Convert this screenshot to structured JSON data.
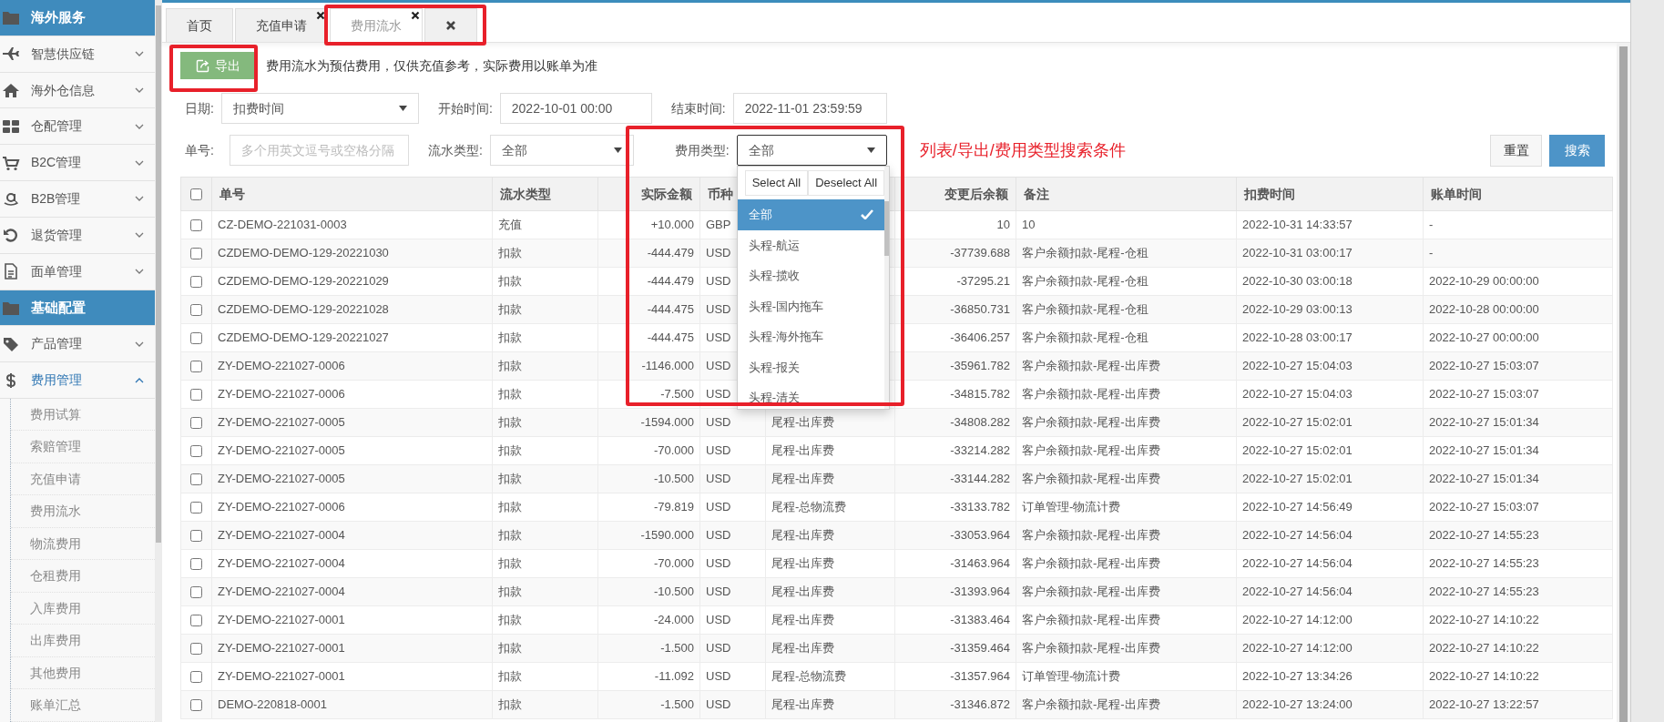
{
  "sidebar": {
    "items": [
      {
        "kind": "section",
        "label": "海外服务"
      },
      {
        "kind": "menu",
        "label": "智慧供应链",
        "expanded": false
      },
      {
        "kind": "menu",
        "label": "海外仓信息",
        "expanded": false
      },
      {
        "kind": "menu",
        "label": "仓配管理",
        "expanded": false
      },
      {
        "kind": "menu",
        "label": "B2C管理",
        "expanded": false
      },
      {
        "kind": "menu",
        "label": "B2B管理",
        "expanded": false
      },
      {
        "kind": "menu",
        "label": "退货管理",
        "expanded": false
      },
      {
        "kind": "menu",
        "label": "面单管理",
        "expanded": false
      },
      {
        "kind": "section",
        "label": "基础配置"
      },
      {
        "kind": "menu",
        "label": "产品管理",
        "expanded": false
      },
      {
        "kind": "menu",
        "label": "费用管理",
        "expanded": true,
        "children": [
          {
            "label": "费用试算"
          },
          {
            "label": "索赔管理"
          },
          {
            "label": "充值申请"
          },
          {
            "label": "费用流水"
          },
          {
            "label": "物流费用"
          },
          {
            "label": "仓租费用"
          },
          {
            "label": "入库费用"
          },
          {
            "label": "出库费用"
          },
          {
            "label": "其他费用"
          },
          {
            "label": "账单汇总"
          }
        ]
      }
    ]
  },
  "tabs": [
    {
      "kind": "page",
      "label": "首页",
      "selected": false,
      "closable": false
    },
    {
      "kind": "page",
      "label": "充值申请",
      "selected": false,
      "closable": true
    },
    {
      "kind": "page",
      "label": "费用流水",
      "selected": true,
      "closable": true
    },
    {
      "kind": "close_all",
      "selected": false
    }
  ],
  "toolbar": {
    "export_button": "导出",
    "notice": "费用流水为预估费用，仅供充值参考，实际费用以账单为准"
  },
  "filters": {
    "date_label": "日期:",
    "date_type": "扣费时间",
    "start_label": "开始时间:",
    "start_time": "2022-10-01 00:00",
    "end_label": "结束时间:",
    "end_time": "2022-11-01 23:59:59",
    "order_label": "单号:",
    "order_placeholder": "多个用英文逗号或空格分隔",
    "flow_type_label": "流水类型:",
    "flow_type": "全部",
    "fee_type_label": "费用类型:",
    "fee_type": "全部",
    "annotation": "列表/导出/费用类型搜索条件",
    "buttons": [
      "重置",
      "搜索"
    ]
  },
  "fee_type_dropdown": {
    "actions": [
      "Select All",
      "Deselect All"
    ],
    "options": [
      {
        "label": "全部",
        "selected": true
      },
      {
        "label": "头程-航运",
        "selected": false
      },
      {
        "label": "头程-揽收",
        "selected": false
      },
      {
        "label": "头程-国内拖车",
        "selected": false
      },
      {
        "label": "头程-海外拖车",
        "selected": false
      },
      {
        "label": "头程-报关",
        "selected": false
      },
      {
        "label": "头程-清关",
        "selected": false
      }
    ]
  },
  "table": {
    "select_all_checked": false,
    "columns": [
      "单号",
      "流水类型",
      "实际金额",
      "币种",
      null,
      "变更后余额",
      "备注",
      "扣费时间",
      "账单时间"
    ],
    "rows": [
      {
        "checked": false,
        "cells": [
          "CZ-DEMO-221031-0003",
          "充值",
          "+10.000",
          "GBP",
          null,
          "10",
          "10",
          "2022-10-31 14:33:57",
          "-"
        ]
      },
      {
        "checked": false,
        "cells": [
          "CZDEMO-DEMO-129-20221030",
          "扣款",
          "-444.479",
          "USD",
          null,
          "-37739.688",
          "客户余额扣款-尾程-仓租",
          "2022-10-31 03:00:17",
          "-"
        ]
      },
      {
        "checked": false,
        "cells": [
          "CZDEMO-DEMO-129-20221029",
          "扣款",
          "-444.479",
          "USD",
          null,
          "-37295.21",
          "客户余额扣款-尾程-仓租",
          "2022-10-30 03:00:18",
          "2022-10-29 00:00:00"
        ]
      },
      {
        "checked": false,
        "cells": [
          "CZDEMO-DEMO-129-20221028",
          "扣款",
          "-444.475",
          "USD",
          null,
          "-36850.731",
          "客户余额扣款-尾程-仓租",
          "2022-10-29 03:00:13",
          "2022-10-28 00:00:00"
        ]
      },
      {
        "checked": false,
        "cells": [
          "CZDEMO-DEMO-129-20221027",
          "扣款",
          "-444.475",
          "USD",
          null,
          "-36406.257",
          "客户余额扣款-尾程-仓租",
          "2022-10-28 03:00:17",
          "2022-10-27 00:00:00"
        ]
      },
      {
        "checked": false,
        "cells": [
          "ZY-DEMO-221027-0006",
          "扣款",
          "-1146.000",
          "USD",
          null,
          "-35961.782",
          "客户余额扣款-尾程-出库费",
          "2022-10-27 15:04:03",
          "2022-10-27 15:03:07"
        ]
      },
      {
        "checked": false,
        "cells": [
          "ZY-DEMO-221027-0006",
          "扣款",
          "-7.500",
          "USD",
          null,
          "-34815.782",
          "客户余额扣款-尾程-出库费",
          "2022-10-27 15:04:03",
          "2022-10-27 15:03:07"
        ]
      },
      {
        "checked": false,
        "cells": [
          "ZY-DEMO-221027-0005",
          "扣款",
          "-1594.000",
          "USD",
          "尾程-出库费",
          "-34808.282",
          "客户余额扣款-尾程-出库费",
          "2022-10-27 15:02:01",
          "2022-10-27 15:01:34"
        ]
      },
      {
        "checked": false,
        "cells": [
          "ZY-DEMO-221027-0005",
          "扣款",
          "-70.000",
          "USD",
          "尾程-出库费",
          "-33214.282",
          "客户余额扣款-尾程-出库费",
          "2022-10-27 15:02:01",
          "2022-10-27 15:01:34"
        ]
      },
      {
        "checked": false,
        "cells": [
          "ZY-DEMO-221027-0005",
          "扣款",
          "-10.500",
          "USD",
          "尾程-出库费",
          "-33144.282",
          "客户余额扣款-尾程-出库费",
          "2022-10-27 15:02:01",
          "2022-10-27 15:01:34"
        ]
      },
      {
        "checked": false,
        "cells": [
          "ZY-DEMO-221027-0006",
          "扣款",
          "-79.819",
          "USD",
          "尾程-总物流费",
          "-33133.782",
          "订单管理-物流计费",
          "2022-10-27 14:56:49",
          "2022-10-27 15:03:07"
        ]
      },
      {
        "checked": false,
        "cells": [
          "ZY-DEMO-221027-0004",
          "扣款",
          "-1590.000",
          "USD",
          "尾程-出库费",
          "-33053.964",
          "客户余额扣款-尾程-出库费",
          "2022-10-27 14:56:04",
          "2022-10-27 14:55:23"
        ]
      },
      {
        "checked": false,
        "cells": [
          "ZY-DEMO-221027-0004",
          "扣款",
          "-70.000",
          "USD",
          "尾程-出库费",
          "-31463.964",
          "客户余额扣款-尾程-出库费",
          "2022-10-27 14:56:04",
          "2022-10-27 14:55:23"
        ]
      },
      {
        "checked": false,
        "cells": [
          "ZY-DEMO-221027-0004",
          "扣款",
          "-10.500",
          "USD",
          "尾程-出库费",
          "-31393.964",
          "客户余额扣款-尾程-出库费",
          "2022-10-27 14:56:04",
          "2022-10-27 14:55:23"
        ]
      },
      {
        "checked": false,
        "cells": [
          "ZY-DEMO-221027-0001",
          "扣款",
          "-24.000",
          "USD",
          "尾程-出库费",
          "-31383.464",
          "客户余额扣款-尾程-出库费",
          "2022-10-27 14:12:00",
          "2022-10-27 14:10:22"
        ]
      },
      {
        "checked": false,
        "cells": [
          "ZY-DEMO-221027-0001",
          "扣款",
          "-1.500",
          "USD",
          "尾程-出库费",
          "-31359.464",
          "客户余额扣款-尾程-出库费",
          "2022-10-27 14:12:00",
          "2022-10-27 14:10:22"
        ]
      },
      {
        "checked": false,
        "cells": [
          "ZY-DEMO-221027-0001",
          "扣款",
          "-11.092",
          "USD",
          "尾程-总物流费",
          "-31357.964",
          "订单管理-物流计费",
          "2022-10-27 13:34:26",
          "2022-10-27 14:10:22"
        ]
      },
      {
        "checked": false,
        "cells": [
          "DEMO-220818-0001",
          "扣款",
          "-1.500",
          "USD",
          "尾程-出库费",
          "-31346.872",
          "客户余额扣款-尾程-出库费",
          "2022-10-27 13:24:00",
          "2022-10-27 13:22:57"
        ]
      }
    ]
  }
}
